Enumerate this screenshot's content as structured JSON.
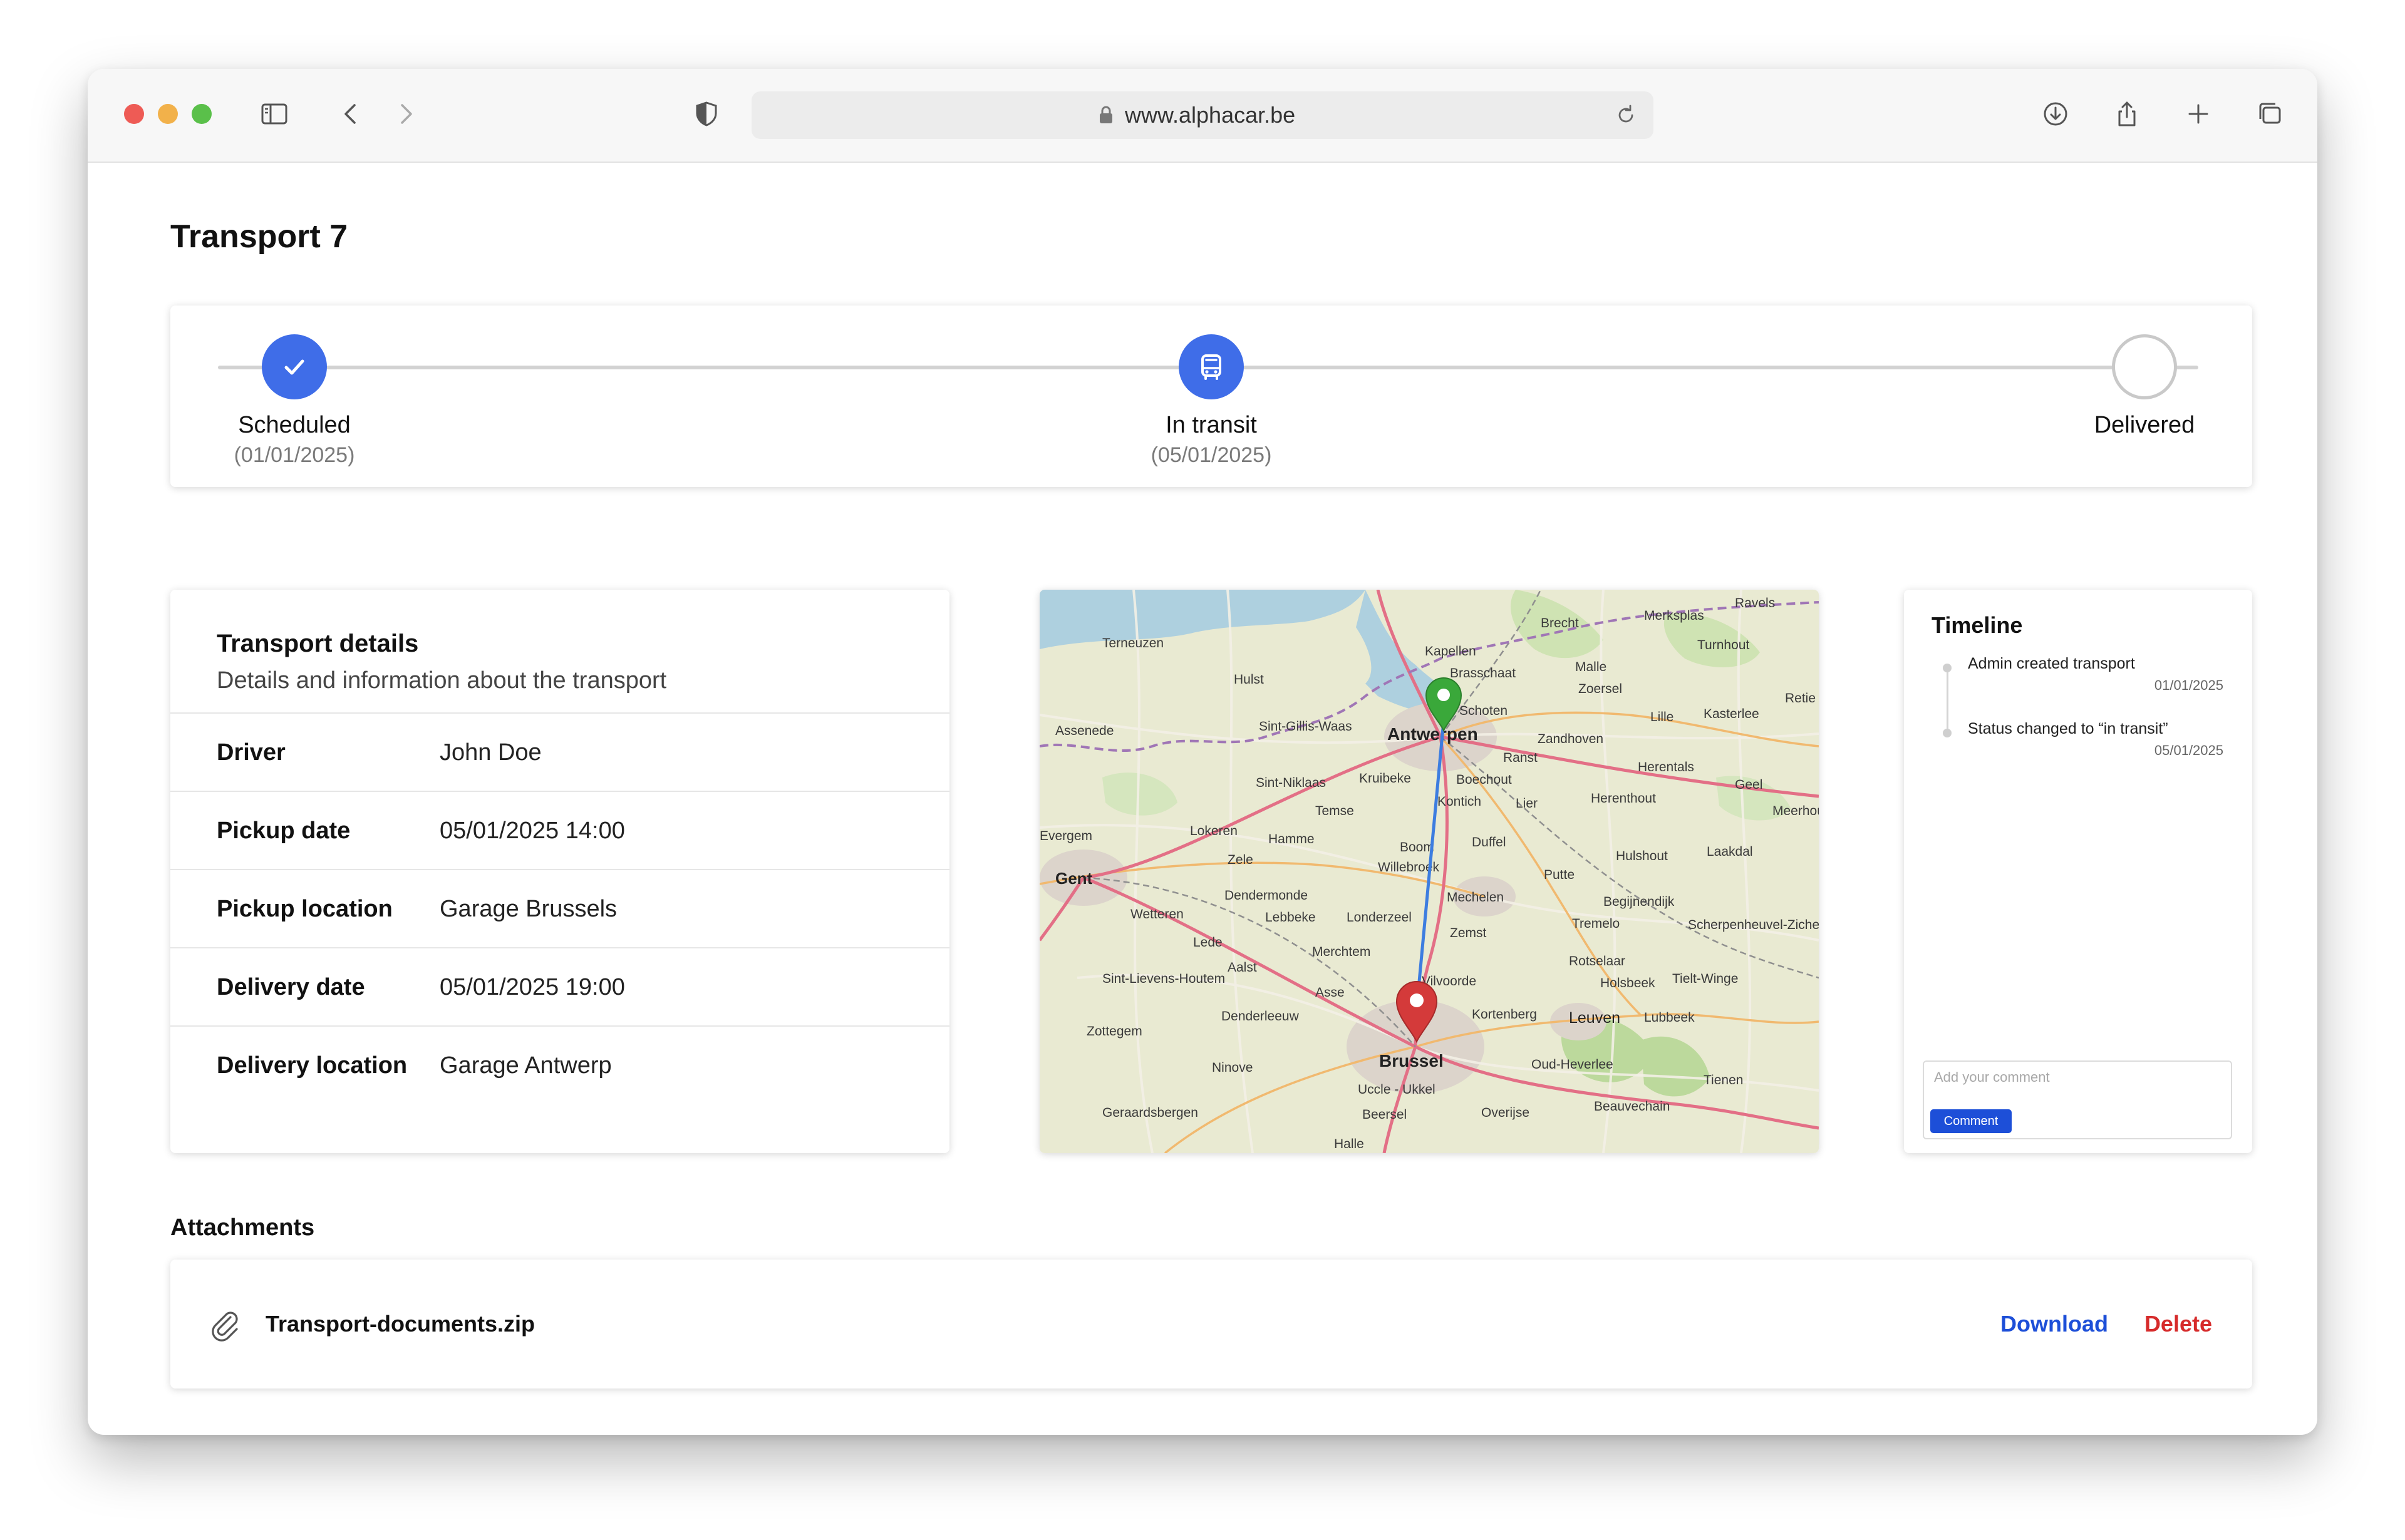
{
  "browser": {
    "url": "www.alphacar.be"
  },
  "page": {
    "title": "Transport 7"
  },
  "status": {
    "steps": [
      {
        "label": "Scheduled",
        "date": "(01/01/2025)",
        "state": "done"
      },
      {
        "label": "In transit",
        "date": "(05/01/2025)",
        "state": "active"
      },
      {
        "label": "Delivered",
        "date": "",
        "state": "pending"
      }
    ]
  },
  "details": {
    "title": "Transport details",
    "subtitle": "Details and information about the transport",
    "rows": [
      {
        "label": "Driver",
        "value": "John Doe"
      },
      {
        "label": "Pickup date",
        "value": "05/01/2025 14:00"
      },
      {
        "label": "Pickup location",
        "value": "Garage Brussels"
      },
      {
        "label": "Delivery date",
        "value": "05/01/2025 19:00"
      },
      {
        "label": "Delivery location",
        "value": "Garage Antwerp"
      }
    ]
  },
  "map": {
    "places": [
      "Terneuzen",
      "Hulst",
      "Kapellen",
      "Brasschaat",
      "Brecht",
      "Merksplas",
      "Ravels",
      "Turnhout",
      "Malle",
      "Zoersel",
      "Schoten",
      "Antwerpen",
      "Sint-Gillis-Waas",
      "Assenede",
      "Zandhoven",
      "Ranst",
      "Lille",
      "Kasterlee",
      "Herentals",
      "Geel",
      "Sint-Niklaas",
      "Kruibeke",
      "Boechout",
      "Kontich",
      "Lier",
      "Herenthout",
      "Temse",
      "Lokeren",
      "Hamme",
      "Boom",
      "Duffel",
      "Zele",
      "Willebroek",
      "Putte",
      "Hulshout",
      "Laakdal",
      "Gent",
      "Dendermonde",
      "Mechelen",
      "Begijnendijk",
      "Wetteren",
      "Lebbeke",
      "Londerzeel",
      "Zemst",
      "Tremelo",
      "Scherpenheuvel-Zichem",
      "Lede",
      "Merchtem",
      "Aalst",
      "Rotselaar",
      "Sint-Lievens-Houtem",
      "Asse",
      "Vilvoorde",
      "Holsbeek",
      "Tielt-Winge",
      "Denderleeuw",
      "Kortenberg",
      "Leuven",
      "Lubbeek",
      "Zottegem",
      "Brussel",
      "Ninove",
      "Oud-Heverlee",
      "Tienen",
      "Uccle - Ukkel",
      "Geraardsbergen",
      "Beersel",
      "Overijse",
      "Beauvechain",
      "Halle",
      "Evergem",
      "Meerhout",
      "Retie"
    ],
    "origin_color": "#3aa83a",
    "destination_color": "#d43a3a",
    "route_color": "#3d7de0"
  },
  "timeline": {
    "title": "Timeline",
    "events": [
      {
        "text": "Admin created transport",
        "date": "01/01/2025"
      },
      {
        "text": "Status changed to “in transit”",
        "date": "05/01/2025"
      }
    ],
    "comment_placeholder": "Add your comment",
    "comment_button": "Comment"
  },
  "attachments": {
    "title": "Attachments",
    "files": [
      {
        "name": "Transport-documents.zip",
        "download_label": "Download",
        "delete_label": "Delete"
      }
    ]
  }
}
